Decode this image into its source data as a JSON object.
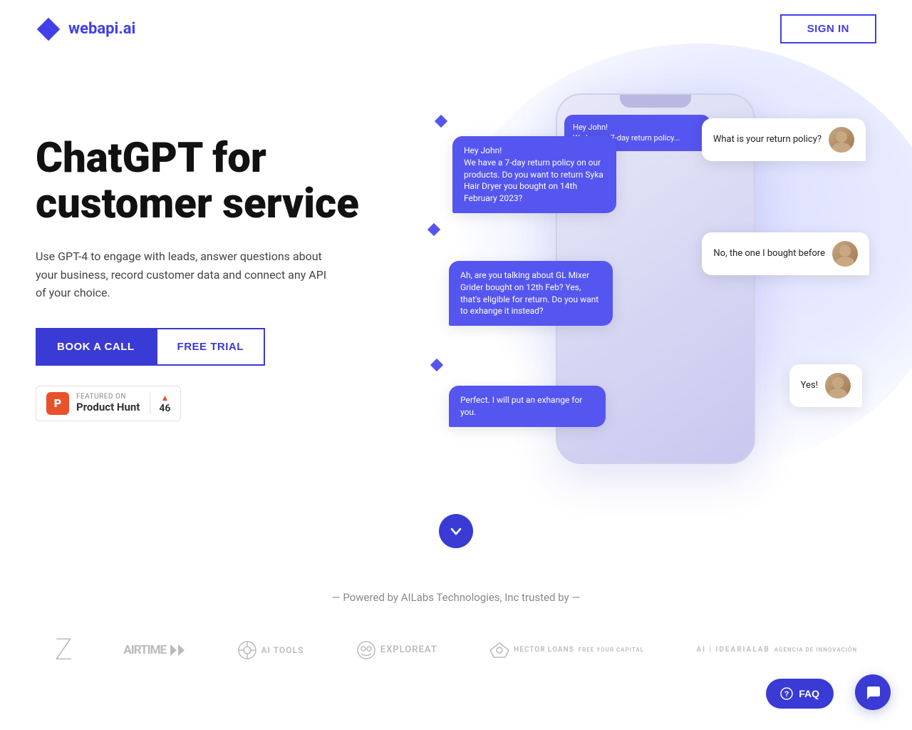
{
  "nav": {
    "logo_text_main": "webapi",
    "logo_text_accent": ".ai",
    "sign_in_label": "SIGN IN"
  },
  "hero": {
    "title_line1": "ChatGPT for",
    "title_line2": "customer service",
    "subtitle": "Use GPT-4 to engage with leads, answer questions about your business, record customer data and connect any API of your choice.",
    "btn_book": "BOOK A CALL",
    "btn_trial": "FREE TRIAL",
    "product_hunt": {
      "featured_label": "FEATURED ON",
      "name": "Product Hunt",
      "votes": "46"
    }
  },
  "chat": {
    "bubble1_user": "What is your return policy?",
    "bubble2_bot": "Hey John!\nWe have a 7-day return policy on our products. Do you want to return Syka Hair Dryer you bought on 14th February 2023?",
    "bubble3_user": "No, the one I bought before",
    "bubble4_bot": "Ah, are you talking about GL Mixer Grider bought on 12th Feb? Yes, that's eligible for return. Do you want to exhange it instead?",
    "bubble5_user": "Yes!",
    "bubble6_bot": "Perfect. I will put an exhange for you."
  },
  "trusted": {
    "text": "— Powered by AILabs Technologies, Inc trusted by —",
    "logos": [
      {
        "name": "Z",
        "style": "large-z"
      },
      {
        "name": "airtime ▶◀",
        "style": "airtime"
      },
      {
        "name": "⚙ AI TOOLS",
        "style": "aitools"
      },
      {
        "name": "◎ exploreat",
        "style": "exploreat"
      },
      {
        "name": "🦅 HECTOR LOANS FREE YOUR CAPITAL",
        "style": "hectorloans"
      },
      {
        "name": "AI IDEARIALAB AGENCIA DE INNOVACIÓN",
        "style": "idearialab"
      }
    ]
  },
  "footer": {
    "faq_label": "FAQ",
    "scroll_down": "▼"
  },
  "colors": {
    "primary": "#3a3ad4",
    "accent": "#5555ef",
    "product_hunt_red": "#e8522b"
  }
}
